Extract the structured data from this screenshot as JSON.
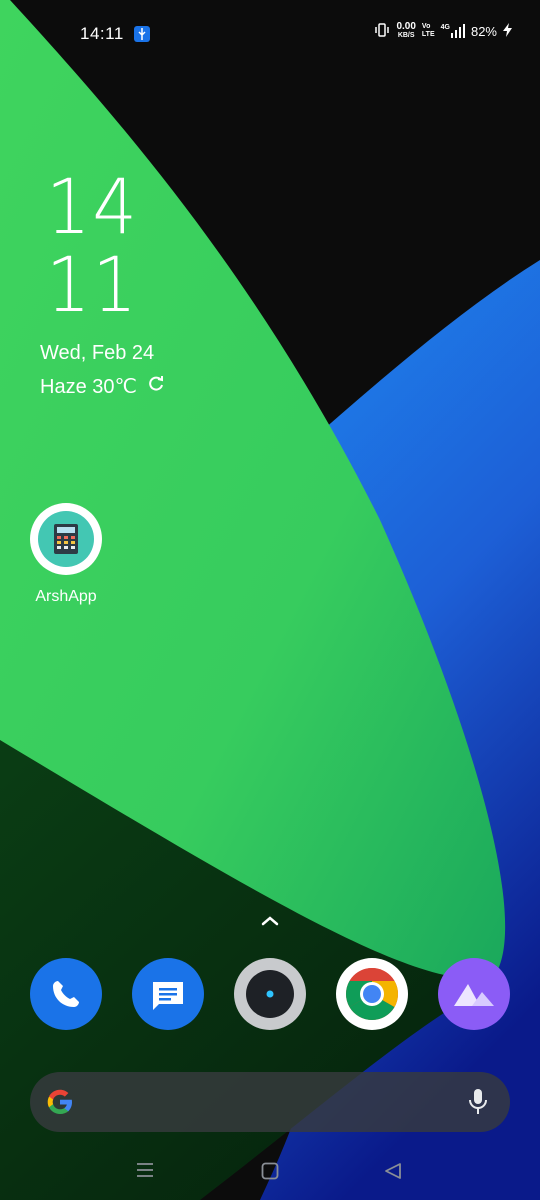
{
  "status_bar": {
    "time": "14:11",
    "net_speed_value": "0.00",
    "net_speed_unit": "KB/S",
    "volte_top": "Vo",
    "volte_bottom": "LTE",
    "network": "4G",
    "battery": "82%",
    "icons": [
      "usb-icon",
      "vibrate-icon",
      "signal-icon",
      "charging-icon"
    ]
  },
  "clock_widget": {
    "hours": "14",
    "minutes": "11",
    "date": "Wed, Feb 24",
    "weather": "Haze 30℃"
  },
  "home_apps": [
    {
      "label": "ArshApp",
      "icon": "calculator-icon"
    }
  ],
  "dock": {
    "apps": [
      {
        "name": "phone",
        "icon": "phone-icon",
        "color": "#1a73e8"
      },
      {
        "name": "messages",
        "icon": "message-icon",
        "color": "#1a73e8"
      },
      {
        "name": "camera",
        "icon": "camera-icon",
        "color": "#c8cacd"
      },
      {
        "name": "chrome",
        "icon": "chrome-icon",
        "color": "#ffffff"
      },
      {
        "name": "gallery",
        "icon": "gallery-icon",
        "color": "#8b5cf6"
      }
    ]
  },
  "search_bar": {
    "icons": [
      "google-g-icon",
      "microphone-icon"
    ]
  },
  "nav_bar": {
    "buttons": [
      "menu-icon",
      "home-icon",
      "back-icon"
    ]
  }
}
